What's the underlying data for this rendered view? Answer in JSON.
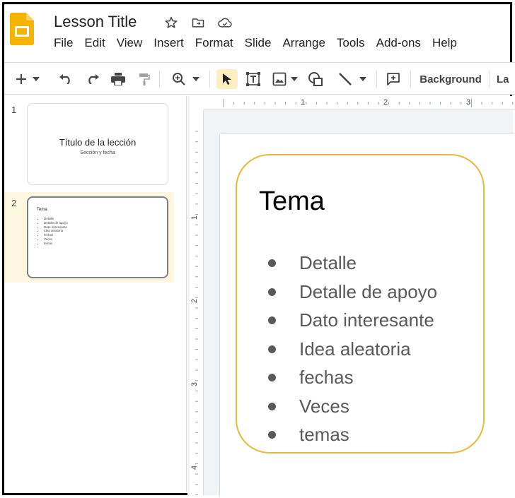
{
  "app": {
    "title": "Lesson Title",
    "brand_color": "#F4B400"
  },
  "menu": [
    "File",
    "Edit",
    "View",
    "Insert",
    "Format",
    "Slide",
    "Arrange",
    "Tools",
    "Add-ons",
    "Help"
  ],
  "toolbar": {
    "background_label": "Background",
    "layout_label_partial": "La",
    "active_tool": "select"
  },
  "filmstrip": {
    "slides": [
      {
        "number": "1",
        "title": "Título de la lección",
        "subtitle": "Sección y fecha"
      },
      {
        "number": "2",
        "title": "Tema",
        "bullets": [
          "Detalle",
          "Detalle de apoyo",
          "Dato interesante",
          "Idea aleatoria",
          "fechas",
          "Veces",
          "temas"
        ]
      }
    ]
  },
  "ruler": {
    "horizontal": [
      "1",
      "2",
      "3"
    ],
    "vertical": [
      "1",
      "2",
      "3",
      "4"
    ]
  },
  "slide": {
    "heading": "Tema",
    "bullets": [
      "Detalle",
      "Detalle de apoyo",
      "Dato interesante",
      "Idea aleatoria",
      "fechas",
      "Veces",
      "temas"
    ],
    "box_border_color": "#E6B93A"
  }
}
